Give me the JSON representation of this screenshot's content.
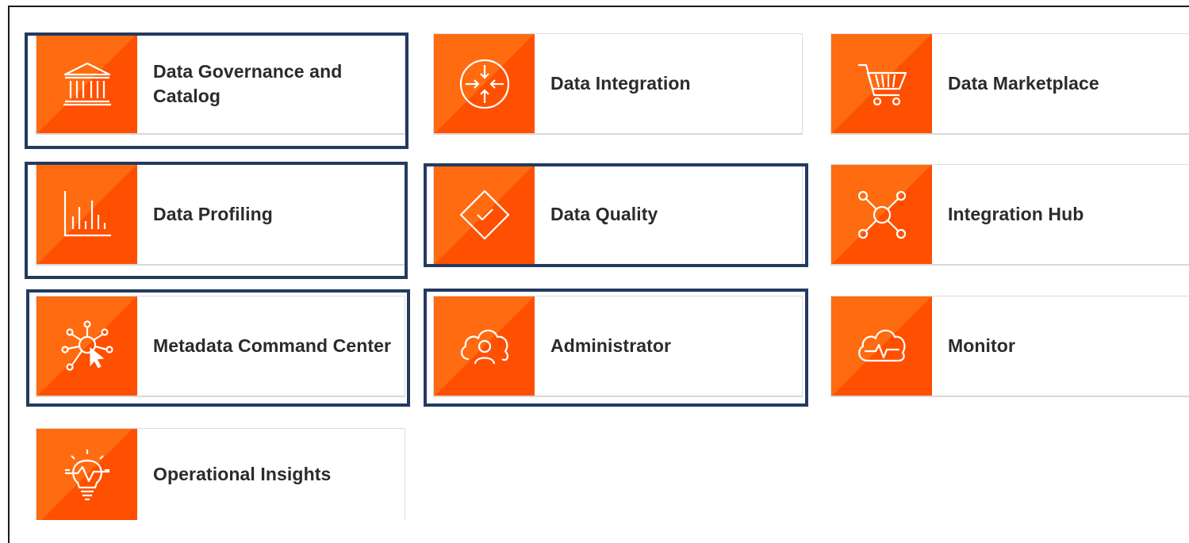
{
  "services": [
    {
      "label": "Data Governance and Catalog",
      "icon": "building-columns-icon"
    },
    {
      "label": "Data Integration",
      "icon": "arrows-converge-icon"
    },
    {
      "label": "Data Marketplace",
      "icon": "shopping-cart-icon"
    },
    {
      "label": "Data Profiling",
      "icon": "bar-chart-icon"
    },
    {
      "label": "Data Quality",
      "icon": "diamond-check-icon"
    },
    {
      "label": "Integration Hub",
      "icon": "hub-network-icon"
    },
    {
      "label": "Metadata Command Center",
      "icon": "network-cursor-icon"
    },
    {
      "label": "Administrator",
      "icon": "cloud-user-icon"
    },
    {
      "label": "Monitor",
      "icon": "cloud-pulse-icon"
    },
    {
      "label": "Operational Insights",
      "icon": "lightbulb-pulse-icon"
    }
  ],
  "colors": {
    "tile_light": "#ff6b10",
    "tile_dark": "#fe5000",
    "highlight_border": "#243a5e",
    "label_text": "#2b2b2b"
  }
}
